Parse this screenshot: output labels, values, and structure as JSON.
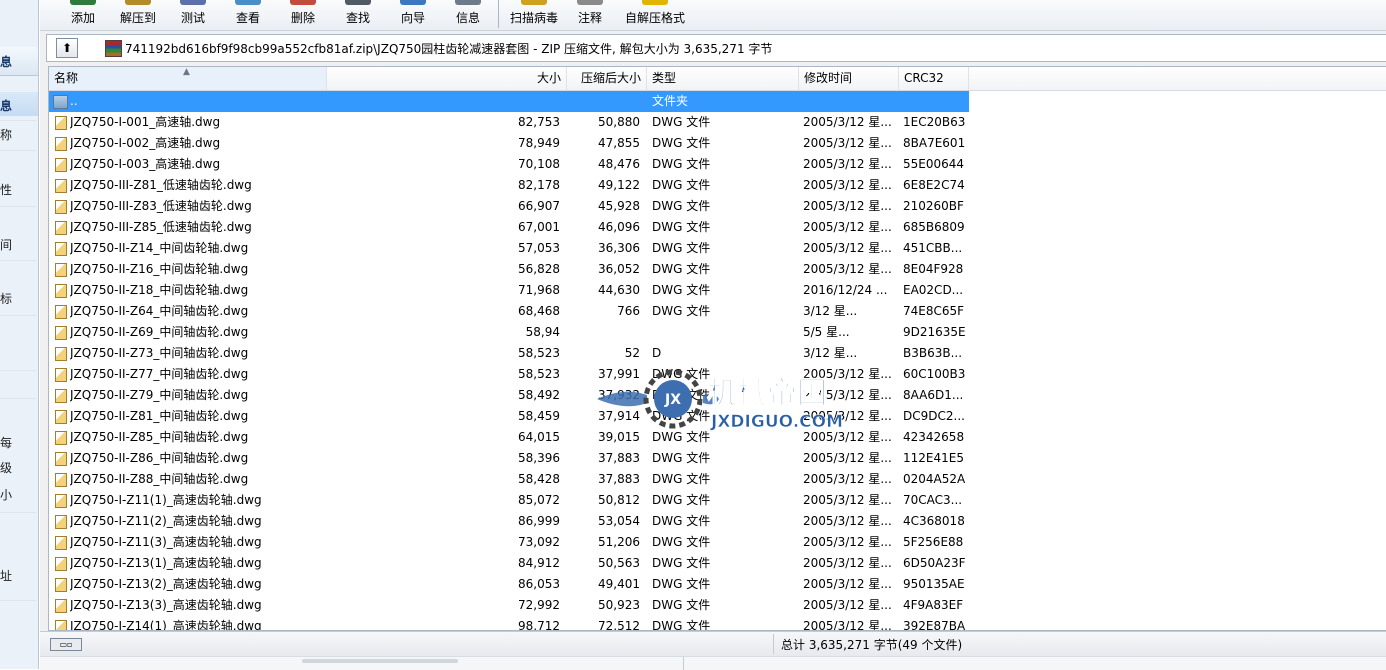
{
  "sidebar": {
    "chars": [
      "息",
      "息",
      "称",
      "性",
      "间",
      "标",
      "每",
      "级",
      "小",
      "址"
    ]
  },
  "toolbar": {
    "buttons": [
      {
        "label": "添加",
        "color": "#2f7a3c"
      },
      {
        "label": "解压到",
        "color": "#b58a2b"
      },
      {
        "label": "测试",
        "color": "#5b6fa8"
      },
      {
        "label": "查看",
        "color": "#4a8ec8"
      },
      {
        "label": "删除",
        "color": "#c24c3c"
      },
      {
        "label": "查找",
        "color": "#505a66"
      },
      {
        "label": "向导",
        "color": "#3b78c0"
      },
      {
        "label": "信息",
        "color": "#6c7a8a"
      },
      {
        "label": "扫描病毒",
        "color": "#d0a020"
      },
      {
        "label": "注释",
        "color": "#8a8a8a"
      },
      {
        "label": "自解压格式",
        "color": "#e0b400"
      }
    ]
  },
  "address": {
    "path": "741192bd616bf9f98cb99a552cfb81af.zip\\JZQ750园柱齿轮减速器套图 - ZIP 压缩文件, 解包大小为 3,635,271 字节"
  },
  "columns": {
    "name": "名称",
    "size": "大小",
    "packed": "压缩后大小",
    "type": "类型",
    "mtime": "修改时间",
    "crc": "CRC32"
  },
  "rows": [
    {
      "name": "..",
      "size": "",
      "packed": "",
      "type": "文件夹",
      "mtime": "",
      "crc": "",
      "folder": true,
      "selected": true
    },
    {
      "name": "JZQ750-I-001_高速轴.dwg",
      "size": "82,753",
      "packed": "50,880",
      "type": "DWG 文件",
      "mtime": "2005/3/12 星...",
      "crc": "1EC20B63"
    },
    {
      "name": "JZQ750-I-002_高速轴.dwg",
      "size": "78,949",
      "packed": "47,855",
      "type": "DWG 文件",
      "mtime": "2005/3/12 星...",
      "crc": "8BA7E601"
    },
    {
      "name": "JZQ750-I-003_高速轴.dwg",
      "size": "70,108",
      "packed": "48,476",
      "type": "DWG 文件",
      "mtime": "2005/3/12 星...",
      "crc": "55E00644"
    },
    {
      "name": "JZQ750-III-Z81_低速轴齿轮.dwg",
      "size": "82,178",
      "packed": "49,122",
      "type": "DWG 文件",
      "mtime": "2005/3/12 星...",
      "crc": "6E8E2C74"
    },
    {
      "name": "JZQ750-III-Z83_低速轴齿轮.dwg",
      "size": "66,907",
      "packed": "45,928",
      "type": "DWG 文件",
      "mtime": "2005/3/12 星...",
      "crc": "210260BF"
    },
    {
      "name": "JZQ750-III-Z85_低速轴齿轮.dwg",
      "size": "67,001",
      "packed": "46,096",
      "type": "DWG 文件",
      "mtime": "2005/3/12 星...",
      "crc": "685B6809"
    },
    {
      "name": "JZQ750-II-Z14_中间齿轮轴.dwg",
      "size": "57,053",
      "packed": "36,306",
      "type": "DWG 文件",
      "mtime": "2005/3/12 星...",
      "crc": "451CBB..."
    },
    {
      "name": "JZQ750-II-Z16_中间齿轮轴.dwg",
      "size": "56,828",
      "packed": "36,052",
      "type": "DWG 文件",
      "mtime": "2005/3/12 星...",
      "crc": "8E04F928"
    },
    {
      "name": "JZQ750-II-Z18_中间齿轮轴.dwg",
      "size": "71,968",
      "packed": "44,630",
      "type": "DWG 文件",
      "mtime": "2016/12/24 ...",
      "crc": "EA02CD..."
    },
    {
      "name": "JZQ750-II-Z64_中间轴齿轮.dwg",
      "size": "68,468",
      "packed": "766",
      "type": "DWG 文件",
      "mtime": "3/12 星...",
      "crc": "74E8C65F"
    },
    {
      "name": "JZQ750-II-Z69_中间轴齿轮.dwg",
      "size": "58,94",
      "packed": "",
      "type": "",
      "mtime": "5/5 星...",
      "crc": "9D21635E"
    },
    {
      "name": "JZQ750-II-Z73_中间轴齿轮.dwg",
      "size": "58,523",
      "packed": "52",
      "type": "D",
      "mtime": "3/12 星...",
      "crc": "B3B63B..."
    },
    {
      "name": "JZQ750-II-Z77_中间轴齿轮.dwg",
      "size": "58,523",
      "packed": "37,991",
      "type": "DWG 文件",
      "mtime": "2005/3/12 星...",
      "crc": "60C100B3"
    },
    {
      "name": "JZQ750-II-Z79_中间轴齿轮.dwg",
      "size": "58,492",
      "packed": "37,932",
      "type": "DWG 文件",
      "mtime": "2005/3/12 星...",
      "crc": "8AA6D1..."
    },
    {
      "name": "JZQ750-II-Z81_中间轴齿轮.dwg",
      "size": "58,459",
      "packed": "37,914",
      "type": "DWG 文件",
      "mtime": "2005/3/12 星...",
      "crc": "DC9DC2..."
    },
    {
      "name": "JZQ750-II-Z85_中间轴齿轮.dwg",
      "size": "64,015",
      "packed": "39,015",
      "type": "DWG 文件",
      "mtime": "2005/3/12 星...",
      "crc": "42342658"
    },
    {
      "name": "JZQ750-II-Z86_中间轴齿轮.dwg",
      "size": "58,396",
      "packed": "37,883",
      "type": "DWG 文件",
      "mtime": "2005/3/12 星...",
      "crc": "112E41E5"
    },
    {
      "name": "JZQ750-II-Z88_中间轴齿轮.dwg",
      "size": "58,428",
      "packed": "37,883",
      "type": "DWG 文件",
      "mtime": "2005/3/12 星...",
      "crc": "0204A52A"
    },
    {
      "name": "JZQ750-I-Z11(1)_高速齿轮轴.dwg",
      "size": "85,072",
      "packed": "50,812",
      "type": "DWG 文件",
      "mtime": "2005/3/12 星...",
      "crc": "70CAC3..."
    },
    {
      "name": "JZQ750-I-Z11(2)_高速齿轮轴.dwg",
      "size": "86,999",
      "packed": "53,054",
      "type": "DWG 文件",
      "mtime": "2005/3/12 星...",
      "crc": "4C368018"
    },
    {
      "name": "JZQ750-I-Z11(3)_高速齿轮轴.dwg",
      "size": "73,092",
      "packed": "51,206",
      "type": "DWG 文件",
      "mtime": "2005/3/12 星...",
      "crc": "5F256E88"
    },
    {
      "name": "JZQ750-I-Z13(1)_高速齿轮轴.dwg",
      "size": "84,912",
      "packed": "50,563",
      "type": "DWG 文件",
      "mtime": "2005/3/12 星...",
      "crc": "6D50A23F"
    },
    {
      "name": "JZQ750-I-Z13(2)_高速齿轮轴.dwg",
      "size": "86,053",
      "packed": "49,401",
      "type": "DWG 文件",
      "mtime": "2005/3/12 星...",
      "crc": "950135AE"
    },
    {
      "name": "JZQ750-I-Z13(3)_高速齿轮轴.dwg",
      "size": "72,992",
      "packed": "50,923",
      "type": "DWG 文件",
      "mtime": "2005/3/12 星...",
      "crc": "4F9A83EF"
    },
    {
      "name": "JZQ750-I-Z14(1)_高速齿轮轴.dwg",
      "size": "98,712",
      "packed": "72,512",
      "type": "DWG 文件",
      "mtime": "2005/3/12 星...",
      "crc": "392E87BA"
    }
  ],
  "watermark": {
    "logo_text": "JX",
    "title": "机械帝国",
    "url": "JXDIGUO.COM"
  },
  "status": {
    "total": "总计 3,635,271 字节(49 个文件)"
  }
}
